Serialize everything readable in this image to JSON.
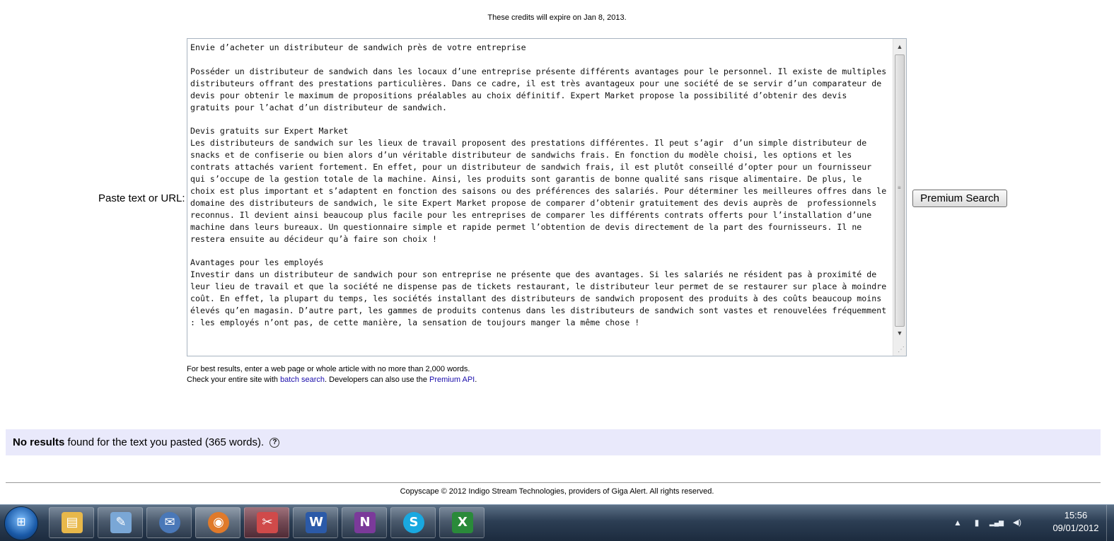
{
  "credits_notice": "These credits will expire on Jan 8, 2013.",
  "paste_label": "Paste text or URL:",
  "textarea": {
    "value": "Envie d’acheter un distributeur de sandwich près de votre entreprise\n\nPosséder un distributeur de sandwich dans les locaux d’une entreprise présente différents avantages pour le personnel. Il existe de multiples distributeurs offrant des prestations particulières. Dans ce cadre, il est très avantageux pour une société de se servir d’un comparateur de devis pour obtenir le maximum de propositions préalables au choix définitif. Expert Market propose la possibilité d’obtenir des devis gratuits pour l’achat d’un distributeur de sandwich.\n\nDevis gratuits sur Expert Market\nLes distributeurs de sandwich sur les lieux de travail proposent des prestations différentes. Il peut s’agir  d’un simple distributeur de snacks et de confiserie ou bien alors d’un véritable distributeur de sandwichs frais. En fonction du modèle choisi, les options et les contrats attachés varient fortement. En effet, pour un distributeur de sandwich frais, il est plutôt conseillé d’opter pour un fournisseur qui s’occupe de la gestion totale de la machine. Ainsi, les produits sont garantis de bonne qualité sans risque alimentaire. De plus, le choix est plus important et s’adaptent en fonction des saisons ou des préférences des salariés. Pour déterminer les meilleures offres dans le domaine des distributeurs de sandwich, le site Expert Market propose de comparer d’obtenir gratuitement des devis auprès de  professionnels reconnus. Il devient ainsi beaucoup plus facile pour les entreprises de comparer les différents contrats offerts pour l’installation d’une machine dans leurs bureaux. Un questionnaire simple et rapide permet l’obtention de devis directement de la part des fournisseurs. Il ne restera ensuite au décideur qu’à faire son choix !\n\nAvantages pour les employés\nInvestir dans un distributeur de sandwich pour son entreprise ne présente que des avantages. Si les salariés ne résident pas à proximité de leur lieu de travail et que la société ne dispense pas de tickets restaurant, le distributeur leur permet de se restaurer sur place à moindre coût. En effet, la plupart du temps, les sociétés installant des distributeurs de sandwich proposent des produits à des coûts beaucoup moins élevés qu’en magasin. D’autre part, les gammes de produits contenus dans les distributeurs de sandwich sont vastes et renouvelées fréquemment : les employés n’ont pas, de cette manière, la sensation de toujours manger la même chose !"
  },
  "premium_search_label": "Premium Search",
  "hint": {
    "line1": "For best results, enter a web page or whole article with no more than 2,000 words.",
    "line2_prefix": "Check your entire site with ",
    "batch_link": "batch search",
    "line2_middle": ". Developers can also use the ",
    "api_link": "Premium API",
    "line2_suffix": "."
  },
  "results": {
    "bold": "No results",
    "rest": " found for the text you pasted (365 words).",
    "help_glyph": "?"
  },
  "footer": "Copyscape © 2012 Indigo Stream Technologies, providers of Giga Alert. All rights reserved.",
  "taskbar": {
    "start_glyph": "⊞",
    "apps": [
      {
        "name": "explorer",
        "glyph": "▤",
        "color": "#e8b84a"
      },
      {
        "name": "notepad",
        "glyph": "✎",
        "color": "#7aa7d6"
      },
      {
        "name": "thunderbird",
        "glyph": "✉",
        "color": "#4a78b8"
      },
      {
        "name": "firefox",
        "glyph": "◉",
        "color": "#e07a2a"
      },
      {
        "name": "snipping-tool",
        "glyph": "✂",
        "color": "#d04a4a"
      },
      {
        "name": "word",
        "glyph": "W",
        "color": "#2b5aa8"
      },
      {
        "name": "onenote",
        "glyph": "N",
        "color": "#7b3a9a"
      },
      {
        "name": "skype",
        "glyph": "S",
        "color": "#19a8e0"
      },
      {
        "name": "excel",
        "glyph": "X",
        "color": "#2a8a3a"
      }
    ],
    "tray": {
      "arrow": "▲",
      "battery": "▮",
      "network": "▂▄▆",
      "volume": "◀)"
    },
    "clock_time": "15:56",
    "clock_date": "09/01/2012"
  }
}
